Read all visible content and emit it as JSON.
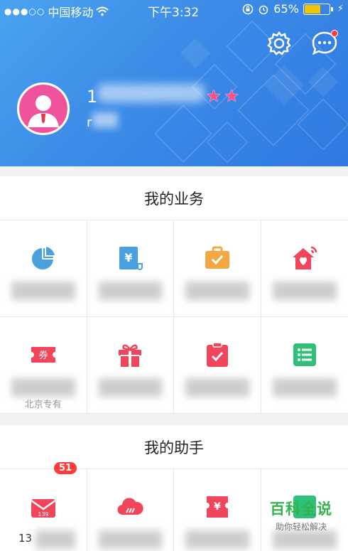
{
  "status_bar": {
    "carrier": "中国移动",
    "time": "下午3:32",
    "battery": "65%",
    "battery_level": 0.65
  },
  "header": {
    "settings_icon": "gear-icon",
    "message_icon": "chat-bubble-icon",
    "phone_prefix": "1",
    "sub_prefix": "r",
    "colors": {
      "gradient_start": "#4aa3ef",
      "gradient_end": "#2f78e0",
      "star": "#ff4d8a"
    }
  },
  "business": {
    "title": "我的业务",
    "items": [
      {
        "icon": "pie-chart-icon",
        "label": "",
        "color": "#4a9fe0"
      },
      {
        "icon": "bill-icon",
        "label": "",
        "color": "#4a9fe0"
      },
      {
        "icon": "briefcase-icon",
        "label": "",
        "color": "#f5a742"
      },
      {
        "icon": "smart-home-icon",
        "label": "",
        "color": "#f0455a"
      },
      {
        "icon": "coupon-icon",
        "label": "",
        "sub": "北京专有",
        "color": "#f0455a"
      },
      {
        "icon": "gift-icon",
        "label": "",
        "color": "#f0455a"
      },
      {
        "icon": "clipboard-check-icon",
        "label": "",
        "color": "#f0455a"
      },
      {
        "icon": "list-icon",
        "label": "",
        "color": "#2fc07a"
      }
    ],
    "coupon_char": "券",
    "bill_char": "¥"
  },
  "assistant": {
    "title": "我的助手",
    "items": [
      {
        "icon": "mail-139-icon",
        "label": "13",
        "badge": "51",
        "color": "#f0455a"
      },
      {
        "icon": "cloud-icon",
        "label": "",
        "color": "#f0455a"
      },
      {
        "icon": "ticket-icon",
        "label": "",
        "color": "#f0455a"
      },
      {
        "icon": "analysis-icon",
        "label": "",
        "color": "#2fc07a"
      }
    ],
    "mail_text": "139",
    "ticket_char": "¥"
  },
  "watermark": {
    "main": "百科全说",
    "sub": "助你轻松解决"
  }
}
